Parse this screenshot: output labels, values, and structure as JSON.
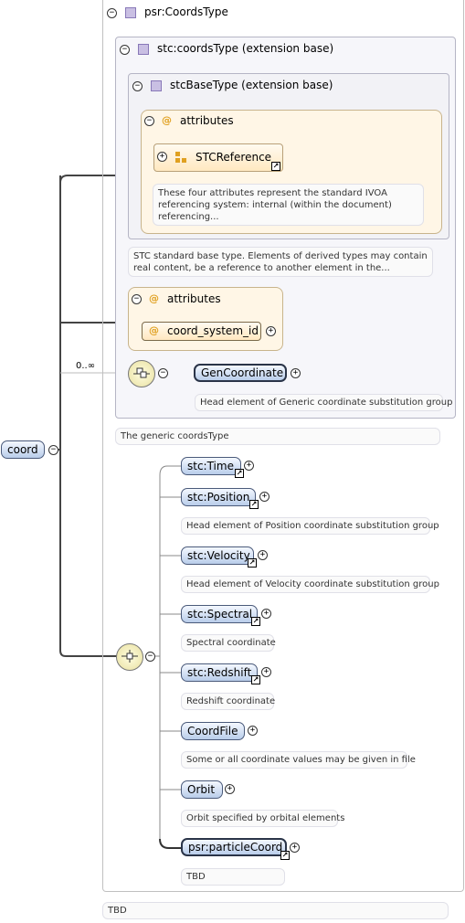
{
  "root": {
    "label": "coord"
  },
  "cardinality": "0..∞",
  "type_panel": {
    "title": "psr:CoordsType",
    "annotation": "TBD"
  },
  "coords_panel": {
    "title": "stc:coordsType (extension base)",
    "annotation": "The generic coordsType"
  },
  "base_panel": {
    "title": "stcBaseType (extension base)",
    "annotation": "STC standard base type. Elements of derived types may contain real content, be a reference to another element in the..."
  },
  "attr_group1": {
    "title": "attributes",
    "item": "STCReference",
    "annotation": "These four attributes represent the standard IVOA referencing system: internal (within the document) referencing..."
  },
  "attr_group2": {
    "title": "attributes",
    "item": "coord_system_id"
  },
  "gen_coordinate": {
    "label": "GenCoordinate",
    "annotation": "Head element of Generic coordinate substitution group"
  },
  "choice_items": [
    {
      "label": "stc:Time",
      "annotation": ""
    },
    {
      "label": "stc:Position",
      "annotation": "Head element of Position coordinate substitution group"
    },
    {
      "label": "stc:Velocity",
      "annotation": "Head element of Velocity coordinate substitution group"
    },
    {
      "label": "stc:Spectral",
      "annotation": "Spectral coordinate"
    },
    {
      "label": "stc:Redshift",
      "annotation": "Redshift coordinate"
    },
    {
      "label": "CoordFile",
      "annotation": "Some or all coordinate values may be given in file"
    },
    {
      "label": "Orbit",
      "annotation": "Orbit specified by orbital elements"
    },
    {
      "label": "psr:particleCoord",
      "annotation": "TBD"
    }
  ],
  "icons": {
    "collapse": "collapse-icon",
    "expand": "expand-icon",
    "type": "complex-type-icon",
    "attribute": "attribute-icon",
    "attribute_group": "attribute-group-icon",
    "link": "link-arrow-icon",
    "sequence": "sequence-icon",
    "choice": "choice-icon"
  },
  "colors": {
    "node_fill": "#b9cdea",
    "node_border": "#4a5a7a",
    "attr_fill": "#fff6e6",
    "attr_border": "#c8b48c",
    "panel_border": "#b5b5c5",
    "type_icon": "#c9bfe3"
  }
}
